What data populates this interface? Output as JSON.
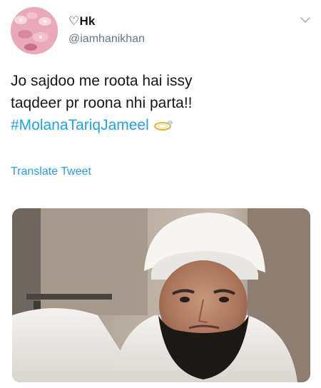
{
  "user": {
    "display_name": "♡Hk",
    "handle": "@iamhanikhan"
  },
  "tweet": {
    "line1": "Jo sajdoo me roota hai issy",
    "line2": "taqdeer pr roona nhi parta!!",
    "hashtag": "#MolanaTariqJameel",
    "emoji": "ring-emoji"
  },
  "actions": {
    "translate_label": "Translate Tweet"
  },
  "colors": {
    "accent": "#1da1f2",
    "text": "#14171a",
    "secondary": "#657786"
  }
}
